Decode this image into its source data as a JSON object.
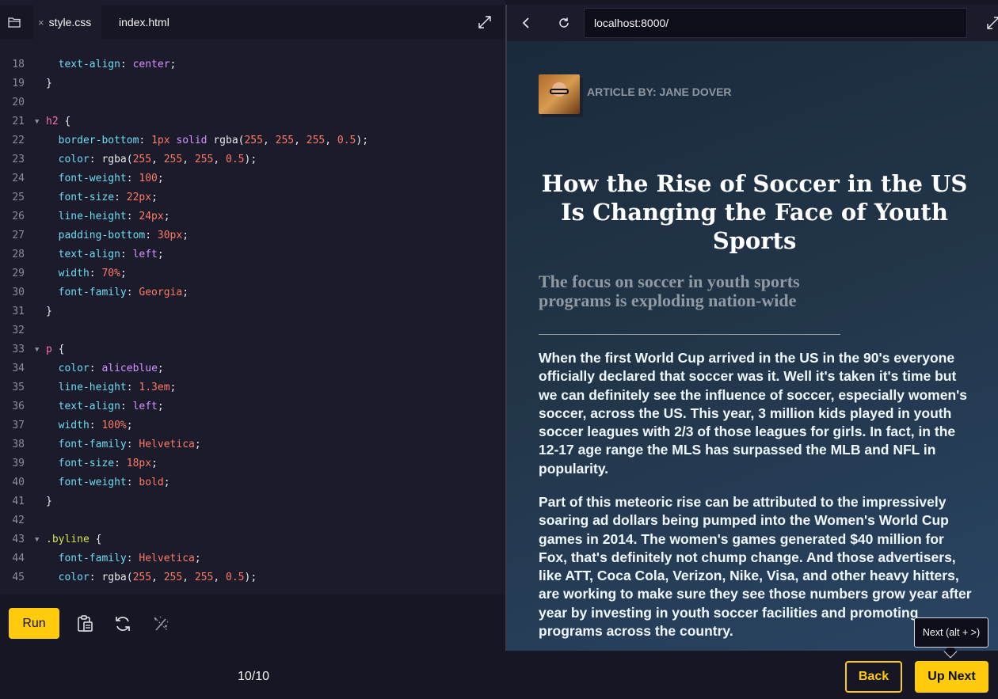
{
  "editor": {
    "tabs": [
      {
        "label": "style.css",
        "close": "×"
      },
      {
        "label": "index.html"
      }
    ],
    "code_lines": [
      {
        "n": "18",
        "fold": "",
        "tokens": [
          [
            "prop",
            "  text-align"
          ],
          [
            "pl",
            ": "
          ],
          [
            "kw",
            "center"
          ],
          [
            "pl",
            ";"
          ]
        ]
      },
      {
        "n": "19",
        "fold": "",
        "tokens": [
          [
            "pl",
            "}"
          ]
        ]
      },
      {
        "n": "20",
        "fold": "",
        "tokens": []
      },
      {
        "n": "21",
        "fold": "▼",
        "tokens": [
          [
            "sel",
            "h2"
          ],
          [
            "pl",
            " {"
          ]
        ]
      },
      {
        "n": "22",
        "fold": "",
        "tokens": [
          [
            "prop",
            "  border-bottom"
          ],
          [
            "pl",
            ": "
          ],
          [
            "num",
            "1px"
          ],
          [
            "pl",
            " "
          ],
          [
            "kw",
            "solid"
          ],
          [
            "pl",
            " rgba("
          ],
          [
            "num",
            "255"
          ],
          [
            "pl",
            ", "
          ],
          [
            "num",
            "255"
          ],
          [
            "pl",
            ", "
          ],
          [
            "num",
            "255"
          ],
          [
            "pl",
            ", "
          ],
          [
            "num",
            "0.5"
          ],
          [
            "pl",
            ");"
          ]
        ]
      },
      {
        "n": "23",
        "fold": "",
        "tokens": [
          [
            "prop",
            "  color"
          ],
          [
            "pl",
            ": rgba("
          ],
          [
            "num",
            "255"
          ],
          [
            "pl",
            ", "
          ],
          [
            "num",
            "255"
          ],
          [
            "pl",
            ", "
          ],
          [
            "num",
            "255"
          ],
          [
            "pl",
            ", "
          ],
          [
            "num",
            "0.5"
          ],
          [
            "pl",
            ");"
          ]
        ]
      },
      {
        "n": "24",
        "fold": "",
        "tokens": [
          [
            "prop",
            "  font-weight"
          ],
          [
            "pl",
            ": "
          ],
          [
            "num",
            "100"
          ],
          [
            "pl",
            ";"
          ]
        ]
      },
      {
        "n": "25",
        "fold": "",
        "tokens": [
          [
            "prop",
            "  font-size"
          ],
          [
            "pl",
            ": "
          ],
          [
            "num",
            "22px"
          ],
          [
            "pl",
            ";"
          ]
        ]
      },
      {
        "n": "26",
        "fold": "",
        "tokens": [
          [
            "prop",
            "  line-height"
          ],
          [
            "pl",
            ": "
          ],
          [
            "num",
            "24px"
          ],
          [
            "pl",
            ";"
          ]
        ]
      },
      {
        "n": "27",
        "fold": "",
        "tokens": [
          [
            "prop",
            "  padding-bottom"
          ],
          [
            "pl",
            ": "
          ],
          [
            "num",
            "30px"
          ],
          [
            "pl",
            ";"
          ]
        ]
      },
      {
        "n": "28",
        "fold": "",
        "tokens": [
          [
            "prop",
            "  text-align"
          ],
          [
            "pl",
            ": "
          ],
          [
            "kw",
            "left"
          ],
          [
            "pl",
            ";"
          ]
        ]
      },
      {
        "n": "29",
        "fold": "",
        "tokens": [
          [
            "prop",
            "  width"
          ],
          [
            "pl",
            ": "
          ],
          [
            "num",
            "70%"
          ],
          [
            "pl",
            ";"
          ]
        ]
      },
      {
        "n": "30",
        "fold": "",
        "tokens": [
          [
            "prop",
            "  font-family"
          ],
          [
            "pl",
            ": "
          ],
          [
            "str",
            "Georgia"
          ],
          [
            "pl",
            ";"
          ]
        ]
      },
      {
        "n": "31",
        "fold": "",
        "tokens": [
          [
            "pl",
            "}"
          ]
        ]
      },
      {
        "n": "32",
        "fold": "",
        "tokens": []
      },
      {
        "n": "33",
        "fold": "▼",
        "tokens": [
          [
            "sel",
            "p"
          ],
          [
            "pl",
            " {"
          ]
        ]
      },
      {
        "n": "34",
        "fold": "",
        "tokens": [
          [
            "prop",
            "  color"
          ],
          [
            "pl",
            ": "
          ],
          [
            "kw",
            "aliceblue"
          ],
          [
            "pl",
            ";"
          ]
        ]
      },
      {
        "n": "35",
        "fold": "",
        "tokens": [
          [
            "prop",
            "  line-height"
          ],
          [
            "pl",
            ": "
          ],
          [
            "num",
            "1.3em"
          ],
          [
            "pl",
            ";"
          ]
        ]
      },
      {
        "n": "36",
        "fold": "",
        "tokens": [
          [
            "prop",
            "  text-align"
          ],
          [
            "pl",
            ": "
          ],
          [
            "kw",
            "left"
          ],
          [
            "pl",
            ";"
          ]
        ]
      },
      {
        "n": "37",
        "fold": "",
        "tokens": [
          [
            "prop",
            "  width"
          ],
          [
            "pl",
            ": "
          ],
          [
            "num",
            "100%"
          ],
          [
            "pl",
            ";"
          ]
        ]
      },
      {
        "n": "38",
        "fold": "",
        "tokens": [
          [
            "prop",
            "  font-family"
          ],
          [
            "pl",
            ": "
          ],
          [
            "str",
            "Helvetica"
          ],
          [
            "pl",
            ";"
          ]
        ]
      },
      {
        "n": "39",
        "fold": "",
        "tokens": [
          [
            "prop",
            "  font-size"
          ],
          [
            "pl",
            ": "
          ],
          [
            "num",
            "18px"
          ],
          [
            "pl",
            ";"
          ]
        ]
      },
      {
        "n": "40",
        "fold": "",
        "tokens": [
          [
            "prop",
            "  font-weight"
          ],
          [
            "pl",
            ": "
          ],
          [
            "str",
            "bold"
          ],
          [
            "pl",
            ";"
          ]
        ]
      },
      {
        "n": "41",
        "fold": "",
        "tokens": [
          [
            "pl",
            "}"
          ]
        ]
      },
      {
        "n": "42",
        "fold": "",
        "tokens": []
      },
      {
        "n": "43",
        "fold": "▼",
        "tokens": [
          [
            "sel-cls",
            ".byline"
          ],
          [
            "pl",
            " {"
          ]
        ]
      },
      {
        "n": "44",
        "fold": "",
        "tokens": [
          [
            "prop",
            "  font-family"
          ],
          [
            "pl",
            ": "
          ],
          [
            "str",
            "Helvetica"
          ],
          [
            "pl",
            ";"
          ]
        ]
      },
      {
        "n": "45",
        "fold": "",
        "tokens": [
          [
            "prop",
            "  color"
          ],
          [
            "pl",
            ": rgba("
          ],
          [
            "num",
            "255"
          ],
          [
            "pl",
            ", "
          ],
          [
            "num",
            "255"
          ],
          [
            "pl",
            ", "
          ],
          [
            "num",
            "255"
          ],
          [
            "pl",
            ", "
          ],
          [
            "num",
            "0.5"
          ],
          [
            "pl",
            ");"
          ]
        ]
      }
    ],
    "run_label": "Run",
    "icons": [
      "folder-icon",
      "close-icon",
      "expand-icon",
      "clipboard-icon",
      "refresh-icon",
      "magic-wand-icon"
    ]
  },
  "browser": {
    "url": "localhost:8000/",
    "icons": [
      "back-arrow-icon",
      "reload-icon",
      "expand-icon"
    ],
    "article": {
      "byline": "ARTICLE BY: JANE DOVER",
      "headline": "How the Rise of Soccer in the US Is Changing the Face of Youth Sports",
      "subhead": "The focus on soccer in youth sports programs is exploding nation-wide",
      "paragraphs": [
        "When the first World Cup arrived in the US in the 90's everyone officially declared that soccer was it. Well it's taken it's time but we can definitely see the influence of soccer, especially women's soccer, across the US. This year, 3 million kids played in youth soccer leagues with 2/3 of those leagues for girls. In fact, in the 12-17 age range the MLS has surpassed the MLB and NFL in popularity.",
        "Part of this meteoric rise can be attributed to the impressively soaring ad dollars being pumped into the Women's World Cup games in 2014. The women's games generated $40 million for Fox, that's definitely not chump change. And those advertisers, like ATT, Coca Cola, Verizon, Nike, Visa, and other heavy hitters, are working to make sure they see those numbers grow year after year by investing in youth soccer facilities and promoting programs across the country."
      ]
    }
  },
  "footer": {
    "progress": "10/10",
    "back_label": "Back",
    "next_label": "Up Next",
    "tooltip": "Next (alt + >)"
  },
  "colors": {
    "accent": "#ffcb0b",
    "editor_bg": "#1b1b2b",
    "chrome_bg": "#161624"
  }
}
